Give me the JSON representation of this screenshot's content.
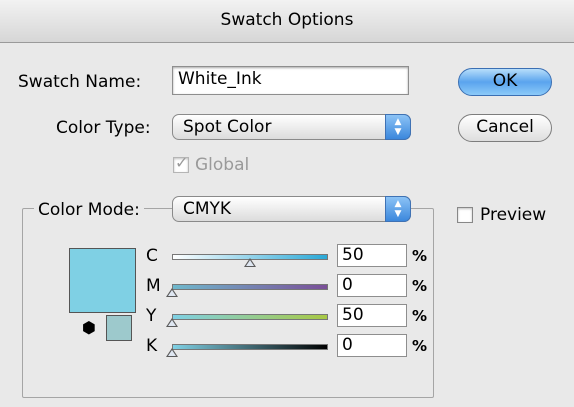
{
  "window": {
    "title": "Swatch Options"
  },
  "form": {
    "swatch_name_label": "Swatch Name:",
    "swatch_name_value": "White_Ink",
    "color_type_label": "Color Type:",
    "color_type_value": "Spot Color",
    "global_label": "Global",
    "global_checked": true,
    "color_mode_label": "Color Mode:",
    "color_mode_value": "CMYK"
  },
  "buttons": {
    "ok": "OK",
    "cancel": "Cancel"
  },
  "preview": {
    "label": "Preview",
    "checked": false
  },
  "swatch_color": "#7fd0e4",
  "old_swatch_color": "#9dc9cc",
  "sliders": [
    {
      "label": "C",
      "value": "50",
      "unit": "%",
      "level": 0.5
    },
    {
      "label": "M",
      "value": "0",
      "unit": "%",
      "level": 0.0
    },
    {
      "label": "Y",
      "value": "50",
      "unit": "%",
      "level": 0.0
    },
    {
      "label": "K",
      "value": "0",
      "unit": "%",
      "level": 0.0
    }
  ],
  "colors": {
    "accent": "#5aa4ee",
    "cyan": "#2aa8d6",
    "magenta": "#7a4f98",
    "yellow": "#a8c844",
    "black": "#000000"
  }
}
